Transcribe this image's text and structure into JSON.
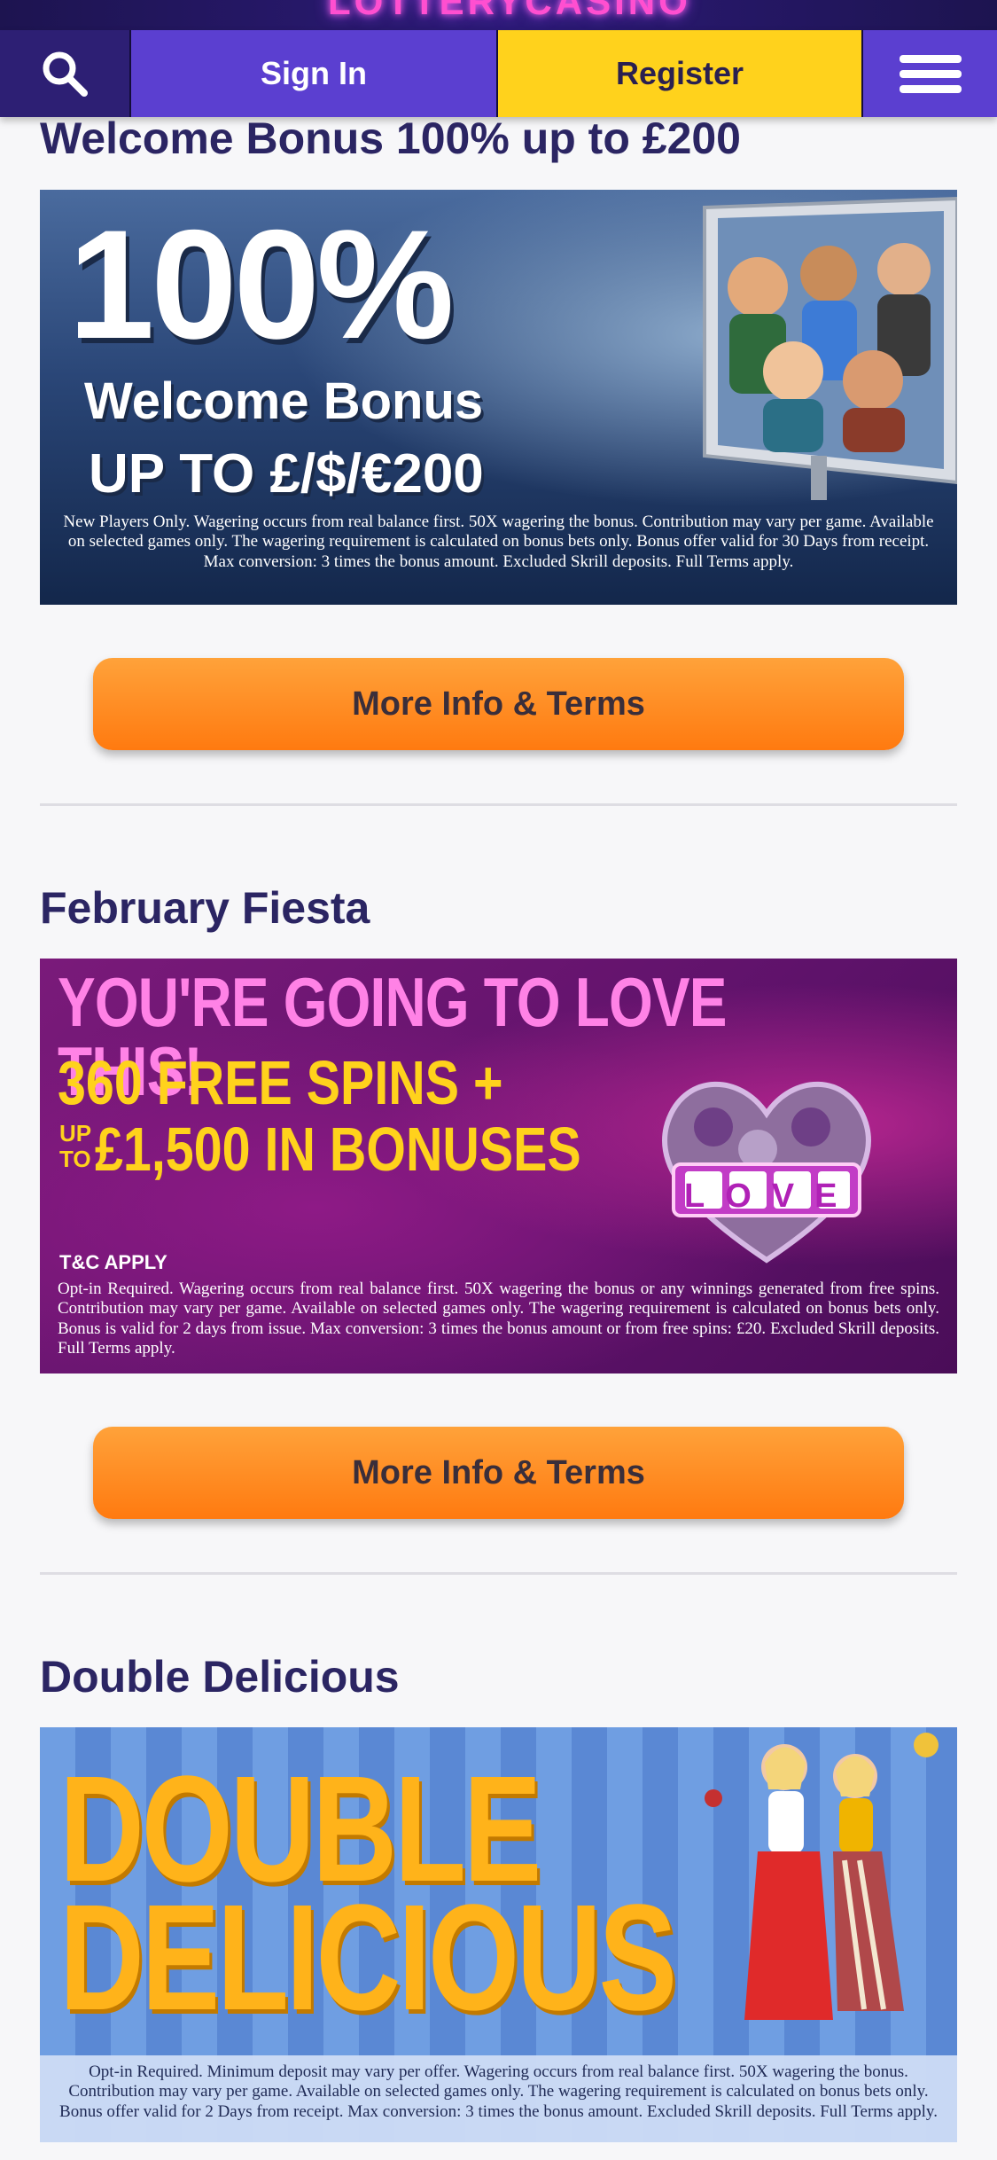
{
  "header": {
    "logo_text": "LOTTERYCASINO",
    "sign_in_label": "Sign In",
    "register_label": "Register"
  },
  "colors": {
    "nav_background": "#1d1450",
    "sign_in": "#5b3fd0",
    "register": "#ffd21c",
    "title_text": "#2b2563",
    "cta_orange": "#ff8a1f"
  },
  "promotions": [
    {
      "title": "Welcome Bonus 100% up to £200",
      "banner": {
        "line1": "100%",
        "line2": "Welcome Bonus",
        "line3": "UP TO £/$/€200",
        "disclaimer": "New Players Only. Wagering occurs from real balance first. 50X wagering the bonus. Contribution may vary per game. Available on selected games only. The wagering requirement is calculated on bonus bets only. Bonus offer valid for 30 Days from receipt. Max conversion: 3 times the bonus amount. Excluded Skrill deposits. Full Terms apply."
      },
      "cta_label": "More Info & Terms"
    },
    {
      "title": "February Fiesta",
      "banner": {
        "line1": "YOU'RE GOING TO LOVE THIS!",
        "line2": "360 FREE SPINS +",
        "line3_prefix": "UP TO",
        "line3": "£1,500 IN BONUSES",
        "badge": "LOVE",
        "tc": "T&C APPLY",
        "disclaimer": "Opt-in Required. Wagering occurs from real balance first. 50X wagering the bonus or any winnings generated from free spins. Contribution may vary per game. Available on selected games only. The wagering requirement is calculated on bonus bets only. Bonus is valid for 2 days from issue. Max conversion: 3 times the bonus amount or from free spins: £20. Excluded Skrill deposits. Full Terms apply."
      },
      "cta_label": "More Info & Terms"
    },
    {
      "title": "Double Delicious",
      "banner": {
        "line1": "DOUBLE",
        "line2": "DELICIOUS",
        "disclaimer": "Opt-in Required. Minimum deposit may vary per offer. Wagering occurs from real balance first. 50X wagering the bonus. Contribution may vary per game. Available on selected games only. The wagering requirement is calculated on bonus bets only. Bonus offer valid for 2 Days from receipt. Max conversion: 3 times the bonus amount. Excluded Skrill deposits. Full Terms apply."
      }
    }
  ]
}
